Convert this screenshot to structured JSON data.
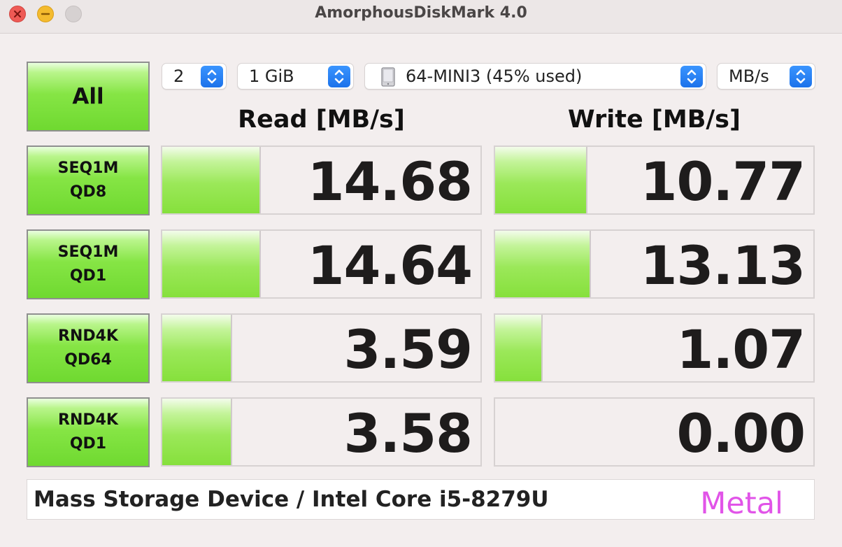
{
  "window": {
    "title": "AmorphousDiskMark 4.0"
  },
  "controls": {
    "count": "2",
    "size": "1 GiB",
    "drive": "64-MINI3 (45% used)",
    "unit": "MB/s",
    "all_label": "All"
  },
  "headers": {
    "read": "Read [MB/s]",
    "write": "Write [MB/s]"
  },
  "tests": [
    {
      "line1": "SEQ1M",
      "line2": "QD8",
      "read": "14.68",
      "write": "10.77"
    },
    {
      "line1": "SEQ1M",
      "line2": "QD1",
      "read": "14.64",
      "write": "13.13"
    },
    {
      "line1": "RND4K",
      "line2": "QD64",
      "read": "3.59",
      "write": "1.07"
    },
    {
      "line1": "RND4K",
      "line2": "QD1",
      "read": "3.58",
      "write": "0.00"
    }
  ],
  "meter_fill": {
    "read": [
      0.31,
      0.31,
      0.22,
      0.22
    ],
    "write": [
      0.29,
      0.3,
      0.15,
      0
    ]
  },
  "footer": {
    "info": "Mass Storage Device / Intel Core i5-8279U",
    "api": "Metal"
  },
  "colors": {
    "accent_green": "#86e03c",
    "api_text": "#e154e8",
    "stepper_blue": "#1c72ea"
  }
}
